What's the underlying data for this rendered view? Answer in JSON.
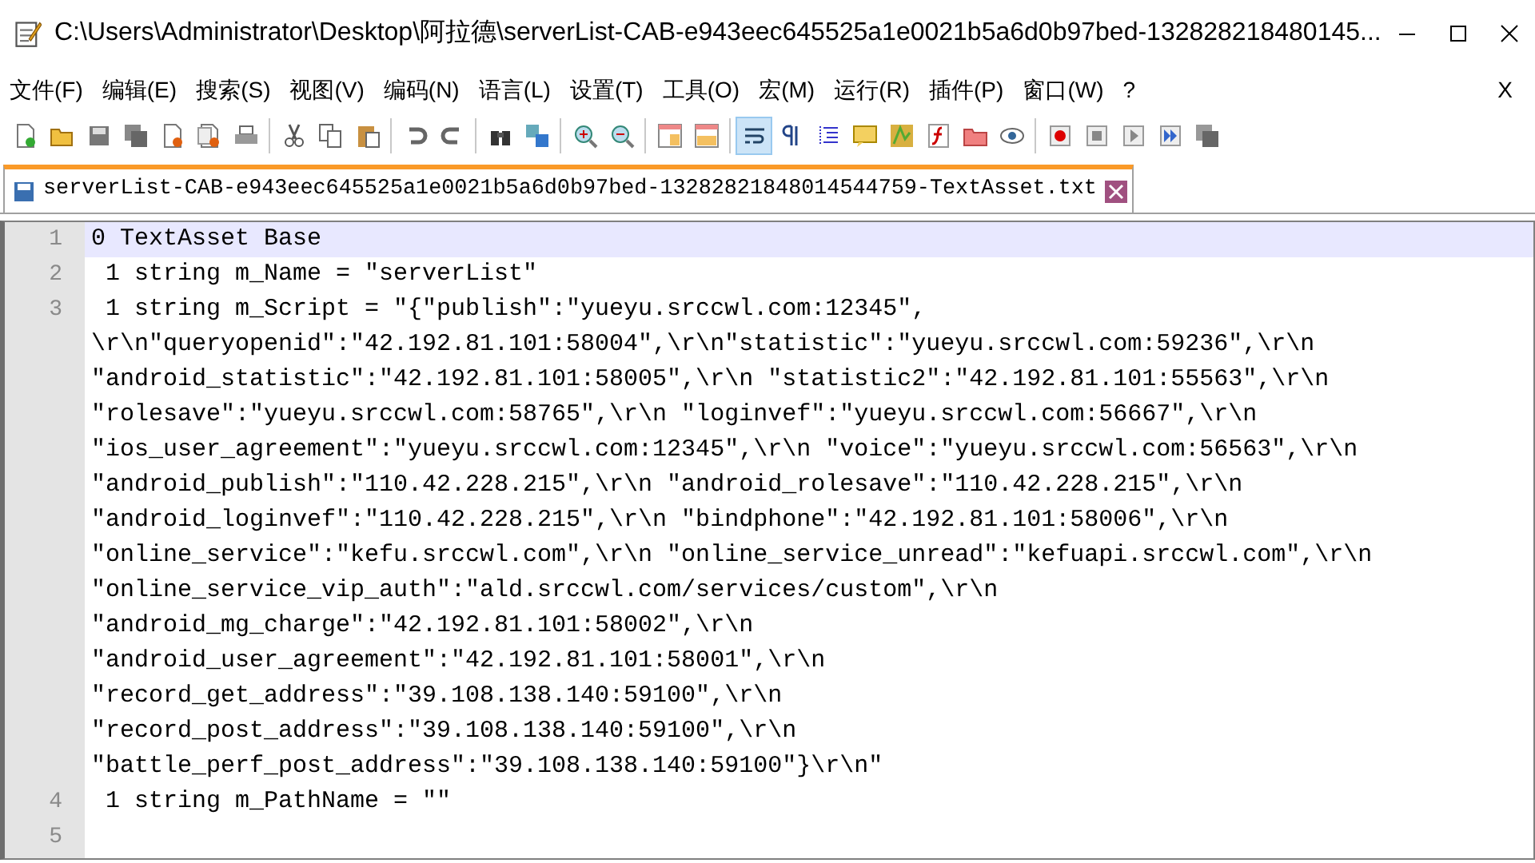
{
  "window": {
    "title": "C:\\Users\\Administrator\\Desktop\\阿拉德\\serverList-CAB-e943eec645525a1e0021b5a6d0b97bed-132828218480145..."
  },
  "menu": [
    "文件(F)",
    "编辑(E)",
    "搜索(S)",
    "视图(V)",
    "编码(N)",
    "语言(L)",
    "设置(T)",
    "工具(O)",
    "宏(M)",
    "运行(R)",
    "插件(P)",
    "窗口(W)",
    "?"
  ],
  "menu_close": "X",
  "tabs": [
    {
      "label": "serverList-CAB-e943eec645525a1e0021b5a6d0b97bed-13282821848014544759-TextAsset.txt",
      "selected": true
    }
  ],
  "editor": {
    "lines": [
      {
        "number": "1",
        "current": true,
        "segments": [
          "0 TextAsset Base"
        ]
      },
      {
        "number": "2",
        "current": false,
        "segments": [
          " 1 string m_Name = \"serverList\""
        ]
      },
      {
        "number": "3",
        "current": false,
        "segments": [
          " 1 string m_Script = \"{\"publish\":\"yueyu.srccwl.com:12345\",",
          "\\r\\n\"queryopenid\":\"42.192.81.101:58004\",\\r\\n\"statistic\":\"yueyu.srccwl.com:59236\",\\r\\n",
          "\"android_statistic\":\"42.192.81.101:58005\",\\r\\n \"statistic2\":\"42.192.81.101:55563\",\\r\\n",
          "\"rolesave\":\"yueyu.srccwl.com:58765\",\\r\\n \"loginvef\":\"yueyu.srccwl.com:56667\",\\r\\n",
          "\"ios_user_agreement\":\"yueyu.srccwl.com:12345\",\\r\\n \"voice\":\"yueyu.srccwl.com:56563\",\\r\\n",
          "\"android_publish\":\"110.42.228.215\",\\r\\n \"android_rolesave\":\"110.42.228.215\",\\r\\n",
          "\"android_loginvef\":\"110.42.228.215\",\\r\\n \"bindphone\":\"42.192.81.101:58006\",\\r\\n",
          "\"online_service\":\"kefu.srccwl.com\",\\r\\n \"online_service_unread\":\"kefuapi.srccwl.com\",\\r\\n",
          "\"online_service_vip_auth\":\"ald.srccwl.com/services/custom\",\\r\\n",
          "\"android_mg_charge\":\"42.192.81.101:58002\",\\r\\n",
          "\"android_user_agreement\":\"42.192.81.101:58001\",\\r\\n",
          "\"record_get_address\":\"39.108.138.140:59100\",\\r\\n",
          "\"record_post_address\":\"39.108.138.140:59100\",\\r\\n",
          "\"battle_perf_post_address\":\"39.108.138.140:59100\"}\\r\\n\""
        ]
      },
      {
        "number": "4",
        "current": false,
        "segments": [
          " 1 string m_PathName = \"\""
        ]
      },
      {
        "number": "5",
        "current": false
      }
    ]
  }
}
